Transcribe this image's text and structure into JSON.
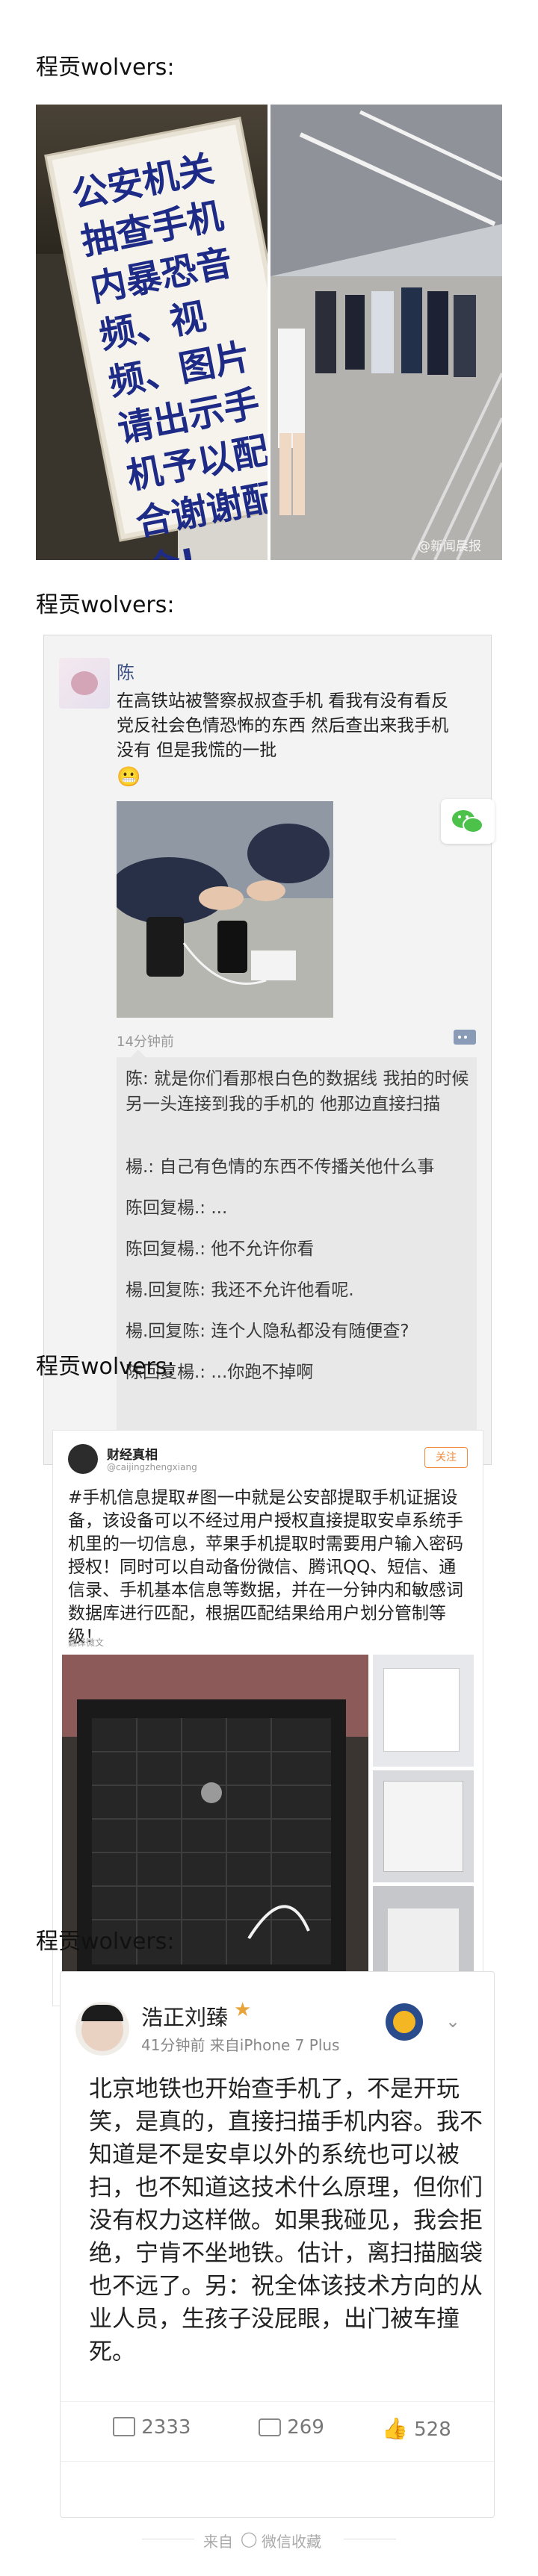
{
  "section_titles": [
    "程贡wolvers:",
    "程贡wolvers:",
    "程贡wolvers:",
    "程贡wolvers:"
  ],
  "post1": {
    "sign_text": "公安机关抽查手机内暴恐音频、视频、图片请出示手机予以配合谢谢配合!",
    "watermark": "@新闻晨报"
  },
  "post2": {
    "user_name": "陈",
    "message": "在高铁站被警察叔叔查手机 看我有没有看反党反社会色情恐怖的东西 然后查出来我手机没有 但是我慌的一批",
    "emoji": "😬",
    "time": "14分钟前",
    "comments": [
      "陈: 就是你们看那根白色的数据线 我拍的时候另一头连接到我的手机的 他那边直接扫描",
      "楊.: 自己有色情的东西不传播关他什么事",
      "陈回复楊.: ...",
      "陈回复楊.: 他不允许你看",
      "楊.回复陈: 我还不允许他看呢.",
      "楊.回复陈: 连个人隐私都没有随便查?",
      "陈回复楊.: ...你跑不掉啊"
    ]
  },
  "post3": {
    "account_name": "财经真相",
    "account_handle": "@caijingzhengxiang",
    "follow_label": "关注",
    "body": "#手机信息提取#图一中就是公安部提取手机证据设备，该设备可以不经过用户授权直接提取安卓系统手机里的一切信息，苹果手机提取时需要用户输入密码授权！同时可以自动备份微信、腾讯QQ、短信、通信录、手机基本信息等数据，并在一分钟内和敏感词数据库进行匹配，根据匹配结果给用户划分管制等级！",
    "translate": "翻译微文"
  },
  "post4": {
    "user_name": "浩正刘臻",
    "meta": "41分钟前  来自iPhone 7 Plus",
    "body": "北京地铁也开始查手机了，不是开玩笑，是真的，直接扫描手机内容。我不知道是不是安卓以外的系统也可以被扫，也不知道这技术什么原理，但你们没有权力这样做。如果我碰见，我会拒绝，宁肯不坐地铁。估计，离扫描脑袋也不远了。另：祝全体该技术方向的从业人员，生孩子没屁眼，出门被车撞死。",
    "repost_count": "2333",
    "comment_count": "269",
    "like_count": "528"
  },
  "footer": {
    "from_text": "来自",
    "source": "微信收藏"
  },
  "colors": {
    "sign_blue": "#1d2b86",
    "wechat_green": "#4cc24a",
    "link_blue": "#3a6fb6"
  }
}
